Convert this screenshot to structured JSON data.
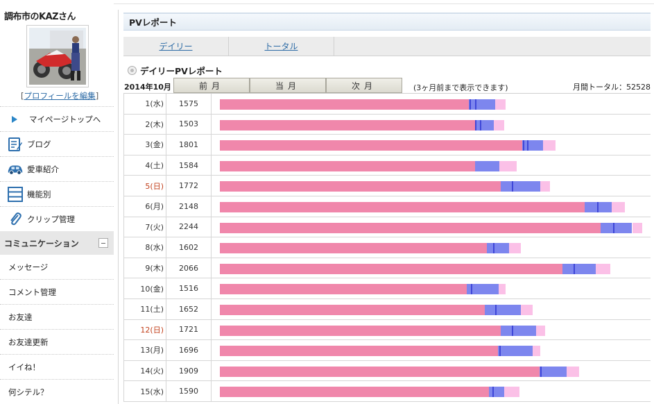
{
  "sidebar": {
    "user_name": "調布市のKAZさん",
    "edit_profile_open": "[",
    "edit_profile": "プロフィールを編集",
    "edit_profile_close": "]",
    "nav": [
      {
        "label": "マイページトップへ",
        "icon": "triangle-right-icon"
      },
      {
        "label": "ブログ",
        "icon": "blog-notepad-icon"
      },
      {
        "label": "愛車紹介",
        "icon": "car-icon"
      },
      {
        "label": "機能別",
        "icon": "list-icon"
      },
      {
        "label": "クリップ管理",
        "icon": "paperclip-icon"
      }
    ],
    "section_title": "コミュニケーション",
    "section_items": [
      "メッセージ",
      "コメント管理",
      "お友達",
      "お友達更新",
      "イイね！",
      "何シテル？"
    ]
  },
  "main": {
    "header_title": "PVレポート",
    "tabs": [
      "デイリー",
      "トータル"
    ],
    "report_title": "デイリーPVレポート",
    "month": "2014年10月",
    "buttons": [
      "前月",
      "当月",
      "次月"
    ],
    "note": "(3ヶ月前まで表示できます)",
    "total_label": "月間トータル：52528"
  },
  "colors": {
    "pv_main": "#f087ab",
    "pv_blue": "#7d86ee",
    "pv_dark_blue": "#3f47d8",
    "pv_light_pink": "#fbc0e7",
    "sunday": "#c2401c",
    "link": "#2b6aa5"
  },
  "chart_data": {
    "type": "bar",
    "orientation": "horizontal",
    "stacked": true,
    "categories": [
      "1(水)",
      "2(木)",
      "3(金)",
      "4(土)",
      "5(日)",
      "6(月)",
      "7(火)",
      "8(水)",
      "9(木)",
      "10(金)",
      "11(土)",
      "12(日)",
      "13(月)",
      "14(火)",
      "15(水)"
    ],
    "counts": [
      1575,
      1503,
      1801,
      1584,
      1772,
      2148,
      2244,
      1602,
      2066,
      1516,
      1652,
      1721,
      1696,
      1909,
      1590
    ],
    "sundays": [
      4,
      11
    ],
    "segments": [
      {
        "pink": 1575,
        "blue": 170,
        "dark": [
          6,
          40
        ],
        "light": 65
      },
      {
        "pink": 1615,
        "blue": 120,
        "dark": [
          2,
          30
        ],
        "light": 65
      },
      {
        "pink": 1915,
        "blue": 130,
        "dark": [
          2,
          30
        ],
        "light": 80
      },
      {
        "pink": 1615,
        "blue": 155,
        "dark": [],
        "light": 110
      },
      {
        "pink": 1780,
        "blue": 250,
        "dark": [
          70
        ],
        "light": 60
      },
      {
        "pink": 2310,
        "blue": 170,
        "dark": [
          80
        ],
        "light": 85
      },
      {
        "pink": 2410,
        "blue": 200,
        "dark": [
          80
        ],
        "light": 65
      },
      {
        "pink": 1690,
        "blue": 140,
        "dark": [
          40
        ],
        "light": 75
      },
      {
        "pink": 2170,
        "blue": 210,
        "dark": [
          70
        ],
        "light": 90
      },
      {
        "pink": 1565,
        "blue": 200,
        "dark": [
          25
        ],
        "light": 45
      },
      {
        "pink": 1675,
        "blue": 230,
        "dark": [
          70
        ],
        "light": 75
      },
      {
        "pink": 1780,
        "blue": 220,
        "dark": [
          70
        ],
        "light": 60
      },
      {
        "pink": 1760,
        "blue": 220,
        "dark": [
          10
        ],
        "light": 50
      },
      {
        "pink": 2025,
        "blue": 170,
        "dark": [
          5
        ],
        "light": 80
      },
      {
        "pink": 1705,
        "blue": 95,
        "dark": [
          20
        ],
        "light": 95
      }
    ],
    "max": 2700
  }
}
